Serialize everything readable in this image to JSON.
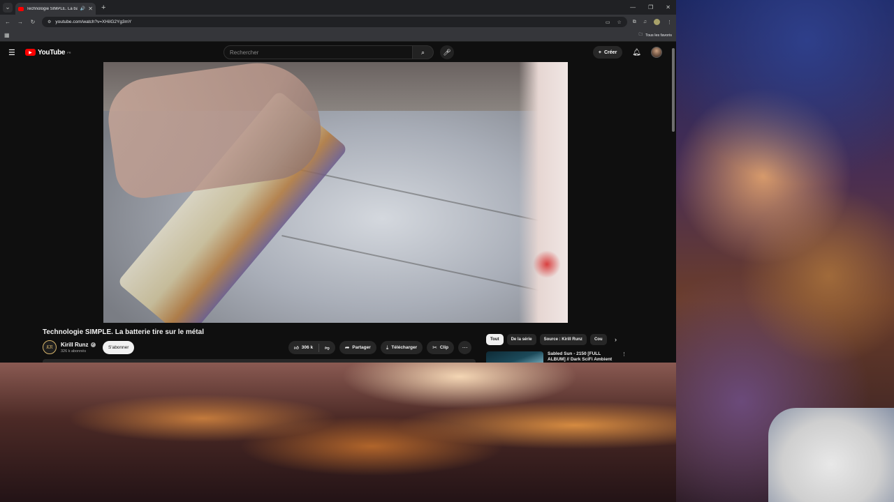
{
  "browser": {
    "tab_title": "Technologie SIMPLE. La batt",
    "url": "youtube.com/watch?v=XHiIG2Yg3mY",
    "all_bookmarks": "Tous les favoris"
  },
  "youtube": {
    "logo_text": "YouTube",
    "country_code": "FR",
    "search_placeholder": "Rechercher",
    "create_label": "Créer"
  },
  "video": {
    "title": "Technologie SIMPLE. La batterie tire sur le métal",
    "channel_name": "Kirill Runz",
    "channel_avatar_text": "KR",
    "subscribers": "326 k abonnés",
    "subscribe_label": "S'abonner",
    "likes": "306 k",
    "share_label": "Partager",
    "download_label": "Télécharger",
    "clip_label": "Clip"
  },
  "chips": [
    "Tout",
    "De la série",
    "Source : Kirill Runz",
    "Cou"
  ],
  "recommendation": {
    "title": "Sabled Sun - 2150 [FULL ALBUM] // Dark SciFi Ambient"
  },
  "icons": {
    "like": "thumbs-up-icon",
    "dislike": "thumbs-down-icon",
    "share": "share-icon",
    "download": "download-icon",
    "clip": "scissors-icon"
  },
  "colors": {
    "yt_background": "#0f0f0f",
    "yt_red": "#ff0000",
    "pill_background": "#272727",
    "chrome_toolbar": "#35363a"
  }
}
